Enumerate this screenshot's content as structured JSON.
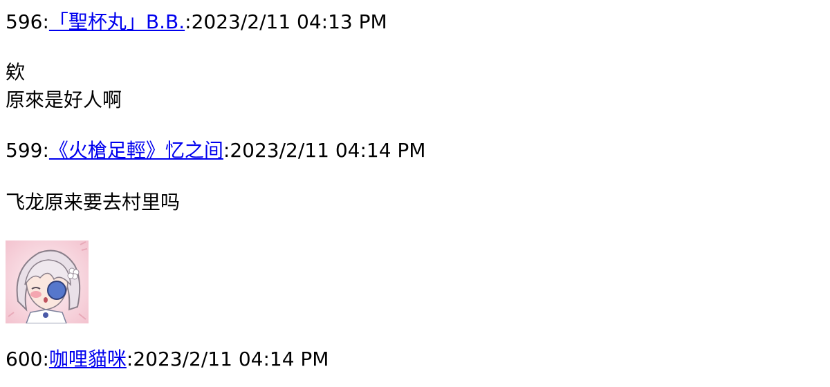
{
  "posts": [
    {
      "number": "596",
      "separator": ":",
      "author": "「聖杯丸」B.B.",
      "separator2": ":",
      "timestamp": "2023/2/11 04:13 PM",
      "lines": [
        "欸",
        "原來是好人啊"
      ]
    },
    {
      "number": "599",
      "separator": ":",
      "author": "《火槍足輕》忆之间",
      "separator2": ":",
      "timestamp": "2023/2/11 04:14 PM",
      "lines": [
        "飞龙原来要去村里吗"
      ]
    },
    {
      "number": "600",
      "separator": ":",
      "author": "咖哩貓咪",
      "separator2": ":",
      "timestamp": "2023/2/11 04:14 PM",
      "lines": []
    }
  ],
  "sticker": {
    "icon": "chibi-girl-sticker-icon",
    "colors": {
      "background": "#f6cfd8",
      "hair": "#e6dde4",
      "eye": "#5577cc",
      "blush": "#f08a9a"
    }
  }
}
